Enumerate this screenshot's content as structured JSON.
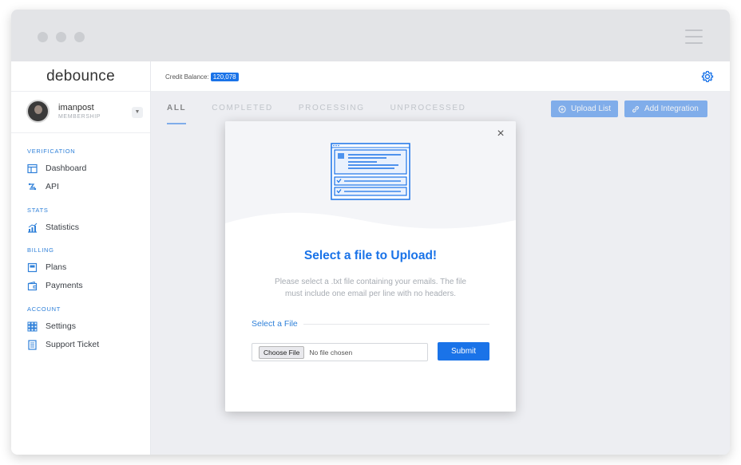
{
  "brand": {
    "logo_text": "debounce"
  },
  "user": {
    "name": "imanpost",
    "role": "MEMBERSHIP"
  },
  "sidebar": {
    "sections": [
      {
        "title": "VERIFICATION",
        "items": [
          {
            "label": "Dashboard",
            "icon": "dashboard-icon"
          },
          {
            "label": "API",
            "icon": "api-icon"
          }
        ]
      },
      {
        "title": "STATS",
        "items": [
          {
            "label": "Statistics",
            "icon": "statistics-icon"
          }
        ]
      },
      {
        "title": "BILLING",
        "items": [
          {
            "label": "Plans",
            "icon": "plans-icon"
          },
          {
            "label": "Payments",
            "icon": "payments-icon"
          }
        ]
      },
      {
        "title": "ACCOUNT",
        "items": [
          {
            "label": "Settings",
            "icon": "settings-grid-icon"
          },
          {
            "label": "Support Ticket",
            "icon": "support-ticket-icon"
          }
        ]
      }
    ]
  },
  "topbar": {
    "credit_label": "Credit Balance:",
    "credit_value": "120,078"
  },
  "tabs": [
    {
      "label": "ALL",
      "active": true
    },
    {
      "label": "COMPLETED"
    },
    {
      "label": "PROCESSING"
    },
    {
      "label": "UNPROCESSED"
    }
  ],
  "actions": {
    "upload_list": "Upload List",
    "add_integration": "Add Integration"
  },
  "modal": {
    "title": "Select a file to Upload!",
    "description": "Please select a .txt file containing your emails. The file must include one email per line with no headers.",
    "file_label": "Select a File",
    "choose_button": "Choose File",
    "no_file_text": "No file chosen",
    "submit_label": "Submit"
  },
  "colors": {
    "accent": "#1a73e8",
    "background": "#f4f5f8"
  }
}
